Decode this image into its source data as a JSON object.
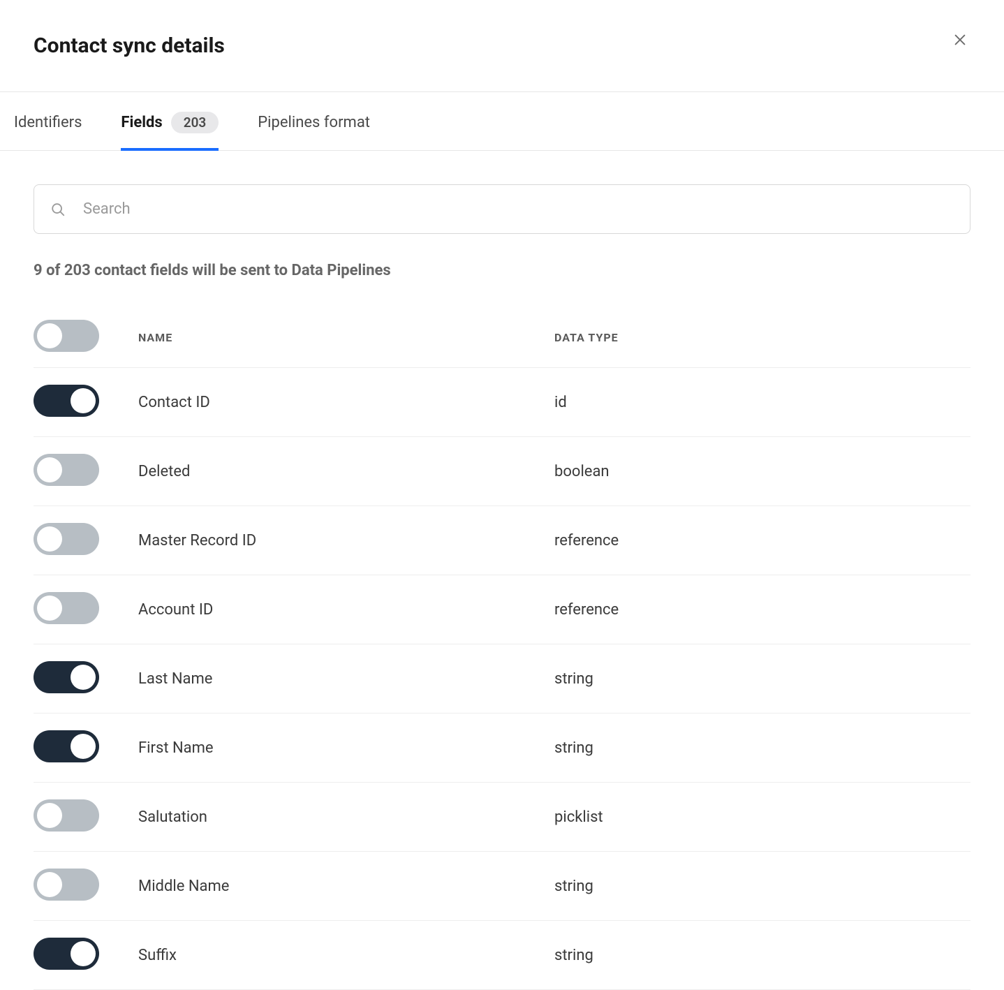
{
  "header": {
    "title": "Contact sync details"
  },
  "tabs": {
    "identifiers": "Identifiers",
    "fields": "Fields",
    "fields_count": "203",
    "pipelines_format": "Pipelines format",
    "active": "fields"
  },
  "search": {
    "placeholder": "Search",
    "value": ""
  },
  "status_text": "9 of 203 contact fields will be sent to Data Pipelines",
  "table": {
    "columns": {
      "name": "NAME",
      "data_type": "DATA TYPE"
    },
    "master_toggle": false,
    "rows": [
      {
        "enabled": true,
        "name": "Contact ID",
        "data_type": "id"
      },
      {
        "enabled": false,
        "name": "Deleted",
        "data_type": "boolean"
      },
      {
        "enabled": false,
        "name": "Master Record ID",
        "data_type": "reference"
      },
      {
        "enabled": false,
        "name": "Account ID",
        "data_type": "reference"
      },
      {
        "enabled": true,
        "name": "Last Name",
        "data_type": "string"
      },
      {
        "enabled": true,
        "name": "First Name",
        "data_type": "string"
      },
      {
        "enabled": false,
        "name": "Salutation",
        "data_type": "picklist"
      },
      {
        "enabled": false,
        "name": "Middle Name",
        "data_type": "string"
      },
      {
        "enabled": true,
        "name": "Suffix",
        "data_type": "string"
      }
    ]
  }
}
